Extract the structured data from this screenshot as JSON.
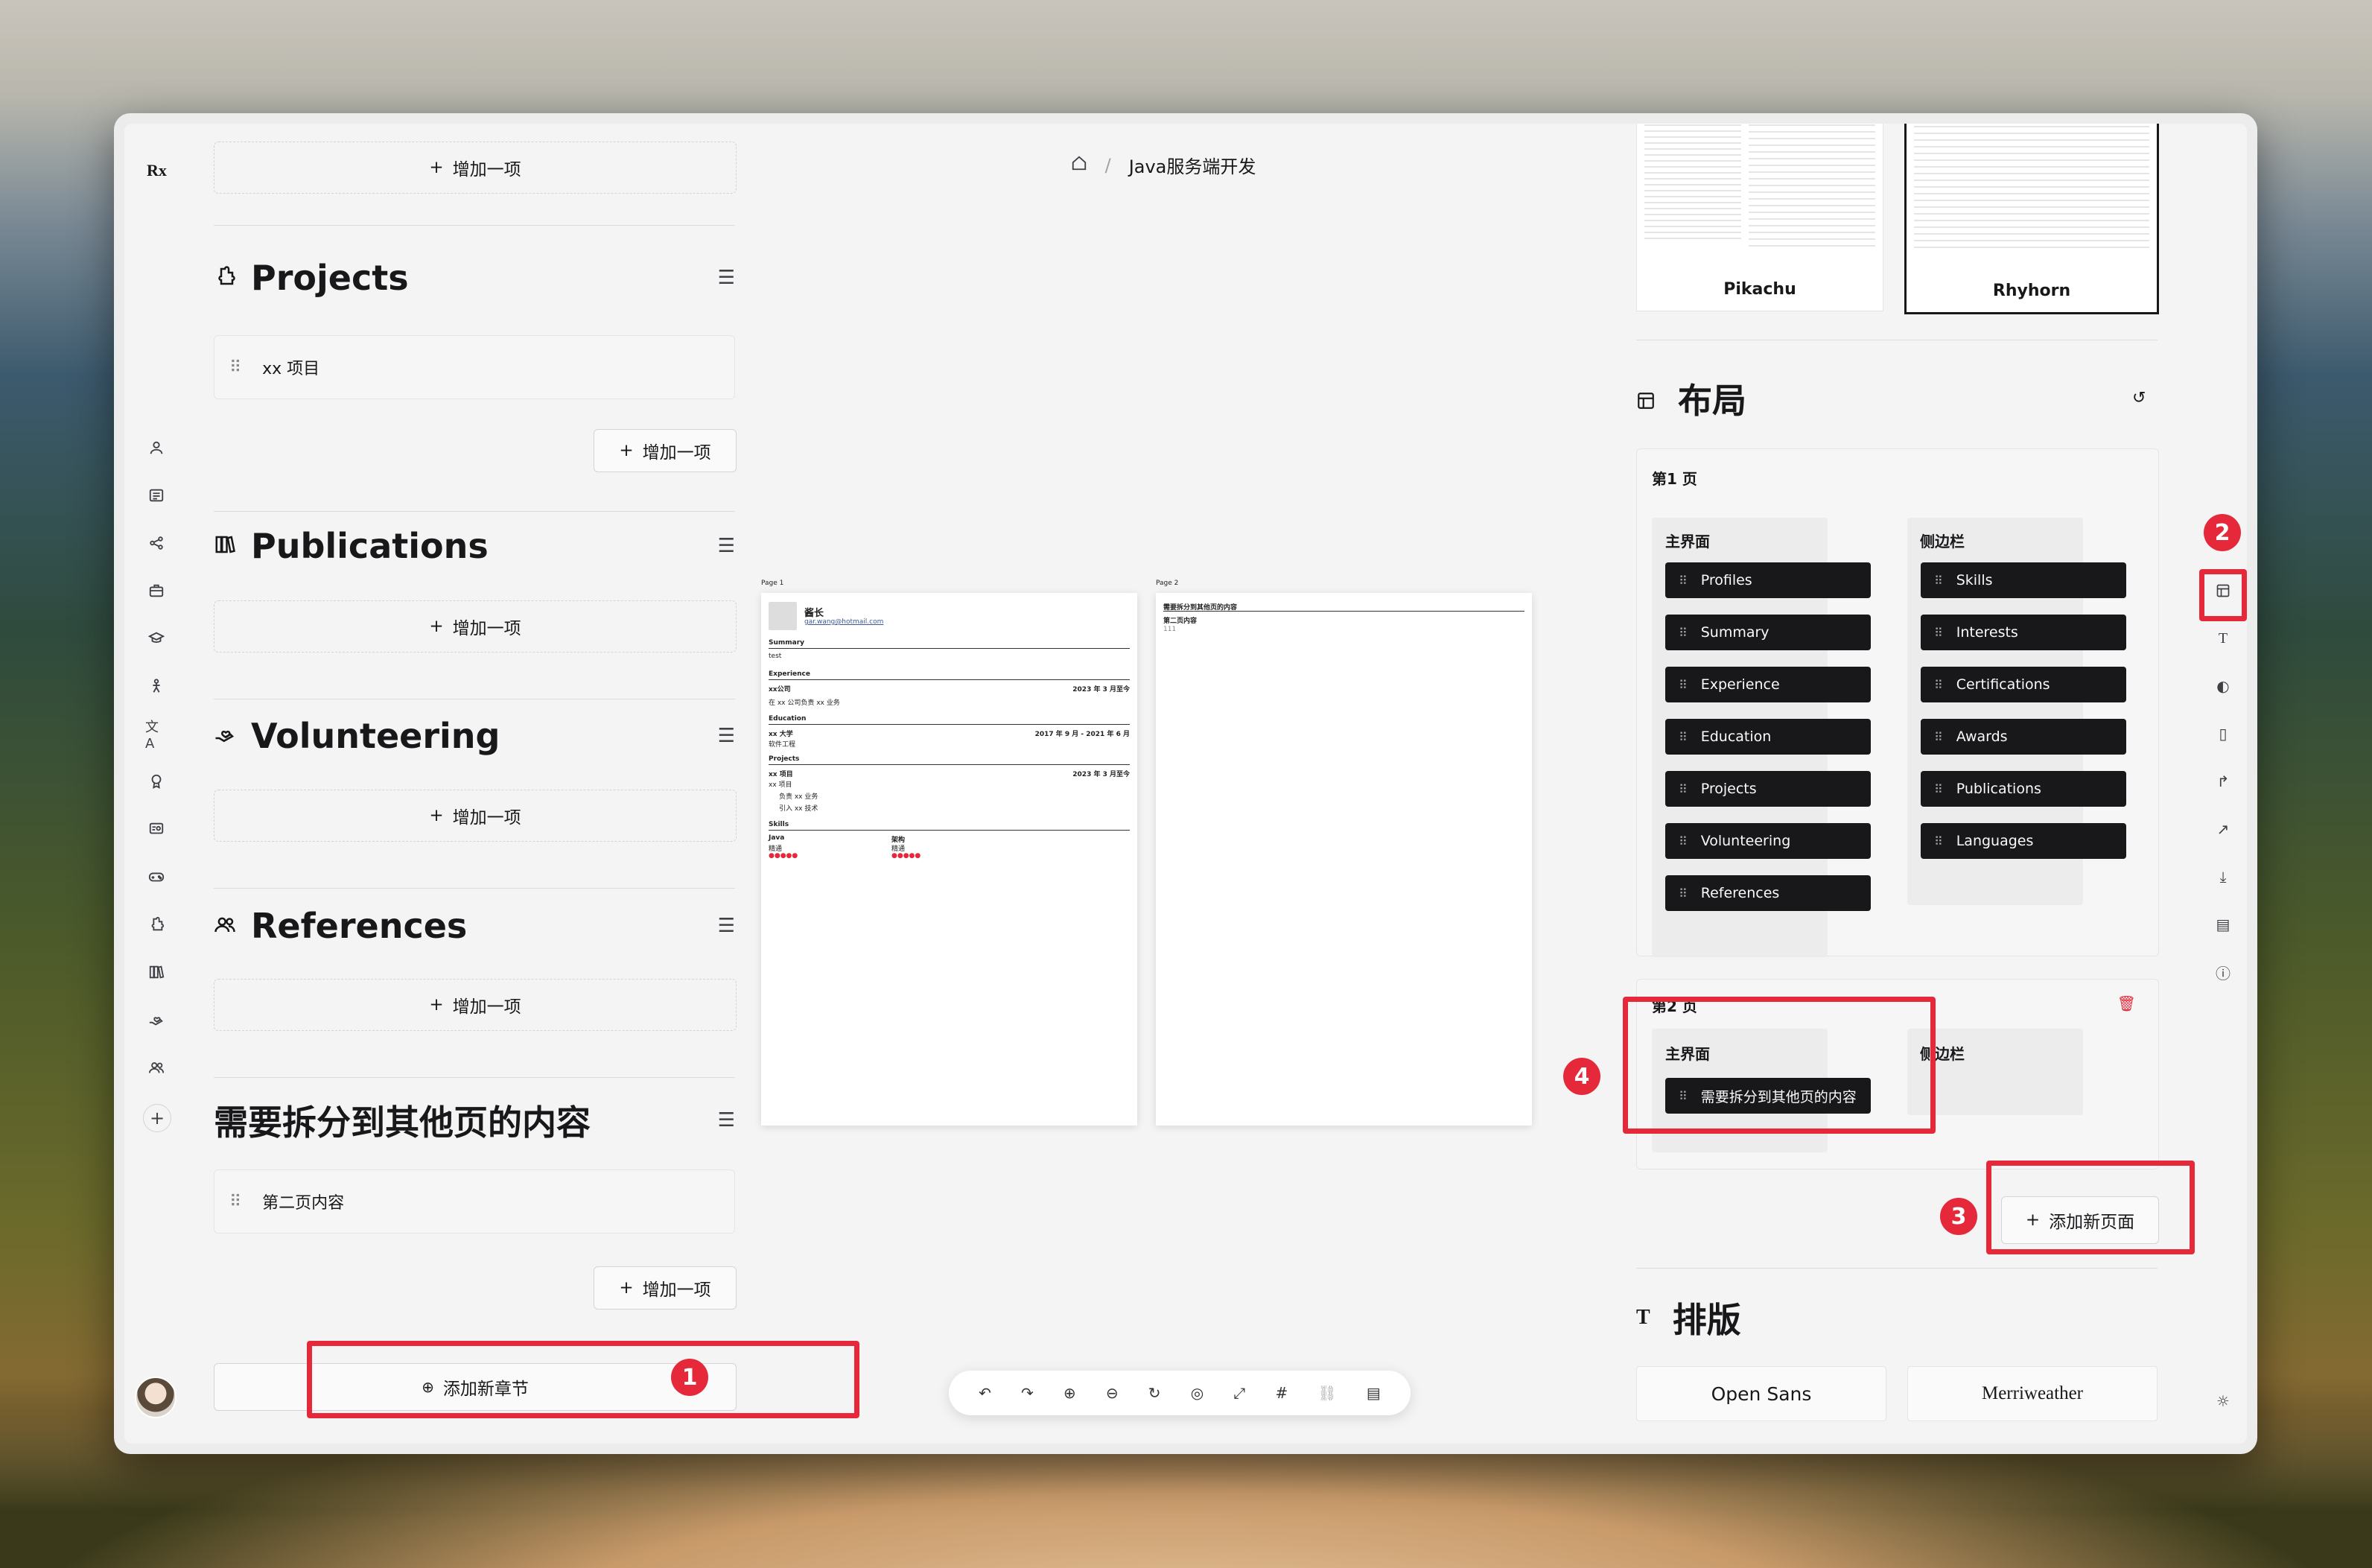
{
  "app": {
    "logo": "Rx"
  },
  "breadcrumb": {
    "home_icon": "home-icon",
    "separator": "/",
    "current": "Java服务端开发"
  },
  "left_rail": {
    "icons": [
      "user-icon",
      "summary-icon",
      "share-icon",
      "briefcase-icon",
      "graduation-icon",
      "person-icon",
      "translate-icon",
      "award-icon",
      "certificate-icon",
      "gamepad-icon",
      "puzzle-icon",
      "books-icon",
      "hand-heart-icon",
      "users-icon",
      "plus-icon"
    ]
  },
  "sections": {
    "add_item_label": "增加一项",
    "projects": {
      "title": "Projects",
      "items": [
        "xx 项目"
      ]
    },
    "publications": {
      "title": "Publications"
    },
    "volunteering": {
      "title": "Volunteering"
    },
    "references": {
      "title": "References"
    },
    "custom": {
      "title": "需要拆分到其他页的内容",
      "items": [
        "第二页内容"
      ]
    },
    "add_section_label": "添加新章节"
  },
  "badges": {
    "b1": "1",
    "b2": "2",
    "b3": "3",
    "b4": "4"
  },
  "preview": {
    "page1": {
      "label": "Page 1",
      "name": "酱长",
      "email": "gar.wang@hotmail.com",
      "summary_h": "Summary",
      "summary_t": "test",
      "exp_h": "Experience",
      "exp_company": "xx公司",
      "exp_date": "2023 年 3 月至今",
      "exp_desc": "在 xx 公司负责 xx 业务",
      "edu_h": "Education",
      "edu_school": "xx 大学",
      "edu_date": "2017 年 9 月 - 2021 年 6 月",
      "edu_major": "软件工程",
      "proj_h": "Projects",
      "proj_name": "xx 项目",
      "proj_date": "2023 年 3 月至今",
      "proj_sub": "xx 项目",
      "proj_b1": "负责 xx 业务",
      "proj_b2": "引入 xx 技术",
      "skills_h": "Skills",
      "skill1": "Java",
      "skill1_lvl": "精通",
      "skill2": "架构",
      "skill2_lvl": "精通"
    },
    "page2": {
      "label": "Page 2",
      "heading": "需要拆分到其他页的内容",
      "sub": "第二页内容",
      "text": "111"
    }
  },
  "toolbar": {
    "icons": [
      "undo-icon",
      "redo-icon",
      "zoom-in-icon",
      "zoom-out-icon",
      "reset-zoom-icon",
      "center-icon",
      "fullscreen-icon",
      "page-break-icon",
      "link-icon",
      "pdf-icon"
    ]
  },
  "templates": [
    {
      "name": "Pikachu"
    },
    {
      "name": "Rhyhorn"
    }
  ],
  "layout": {
    "title": "布局",
    "page1_label": "第1 页",
    "page2_label": "第2 页",
    "main_label": "主界面",
    "sidebar_label": "侧边栏",
    "page1_main": [
      "Profiles",
      "Summary",
      "Experience",
      "Education",
      "Projects",
      "Volunteering",
      "References"
    ],
    "page1_sidebar": [
      "Skills",
      "Interests",
      "Certifications",
      "Awards",
      "Publications",
      "Languages"
    ],
    "page2_main": [
      "需要拆分到其他页的内容"
    ],
    "add_page_label": "添加新页面"
  },
  "typography": {
    "title": "排版",
    "fonts": [
      "Open Sans",
      "Merriweather"
    ]
  },
  "right_rail": {
    "icons": [
      "template-icon",
      "layout-icon",
      "typography-icon",
      "theme-icon",
      "page-icon",
      "share-icon",
      "stats-icon",
      "download-icon",
      "notes-icon",
      "info-icon",
      "sun-icon"
    ]
  }
}
